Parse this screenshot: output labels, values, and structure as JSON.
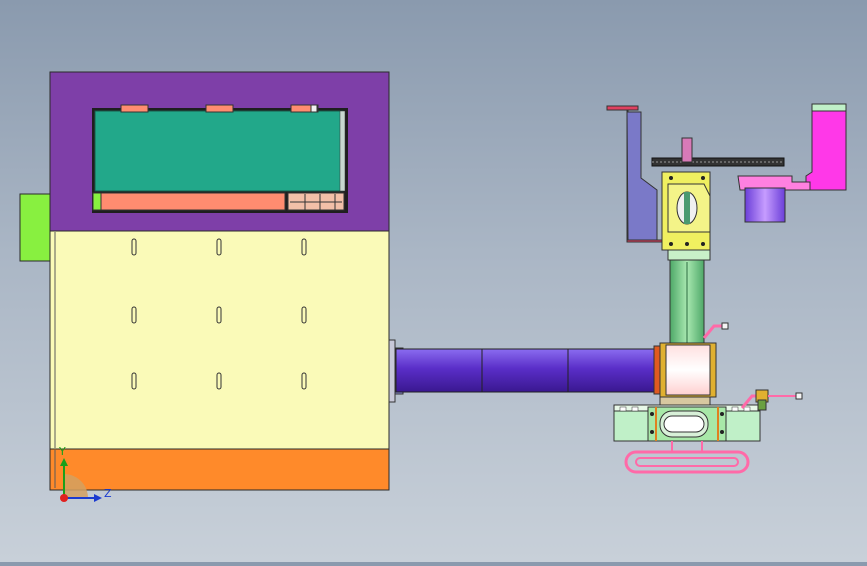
{
  "viewport": {
    "colors": {
      "bg_top": "#8a9aae",
      "bg_bottom": "#c8d0d9",
      "housing_frame": "#7e3fa8",
      "housing_body": "#fafab8",
      "housing_base": "#ff8a2a",
      "side_block": "#88f040",
      "inner_panel": "#22a88a",
      "salmon_bar": "#ff8c70",
      "tube": "#5a2ec8",
      "cylinder_gold": "#e0b030",
      "cylinder_white": "#ffffff",
      "green_column": "#79c98a",
      "yellow_block": "#f0f060",
      "magenta_arm": "#ff38e8",
      "bracket": "#7a79c8",
      "base_pad": "#c0f0c8",
      "pink_loop": "#ff6aa8"
    }
  },
  "triad": {
    "y_label": "Y",
    "z_label": "Z"
  }
}
